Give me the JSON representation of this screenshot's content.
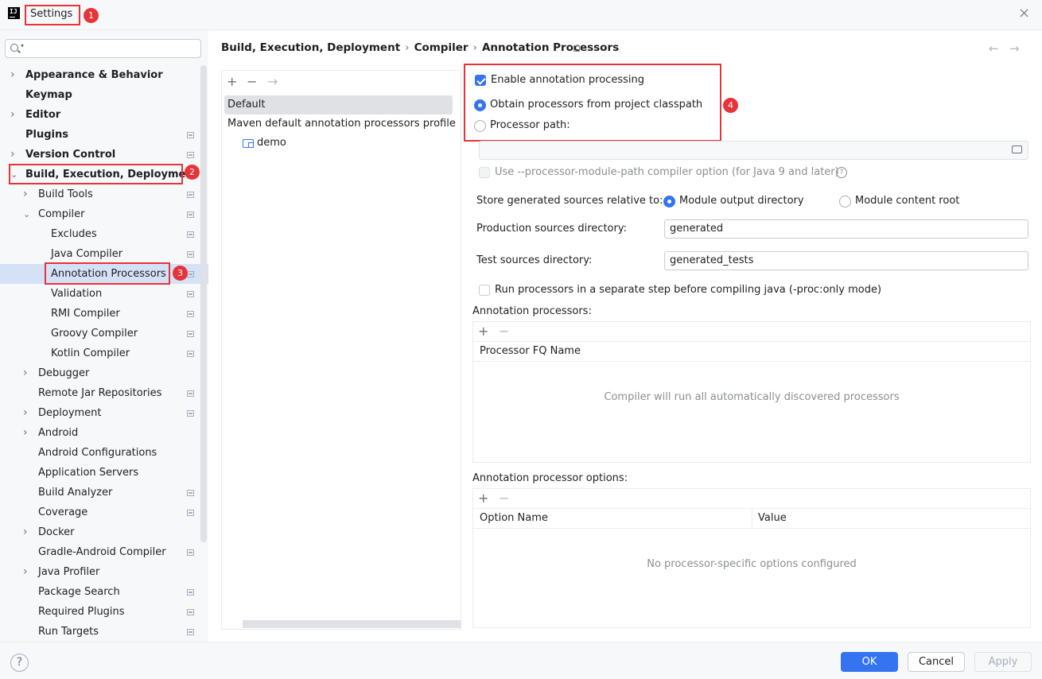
{
  "window": {
    "title": "Settings",
    "app_icon": "IJ",
    "close_icon": "×"
  },
  "badges": [
    "1",
    "2",
    "3",
    "4"
  ],
  "search": {
    "value": "",
    "placeholder": ""
  },
  "tree": [
    {
      "label": "Appearance & Behavior",
      "bold": true,
      "chevron": "right",
      "level": 0,
      "pin": false
    },
    {
      "label": "Keymap",
      "bold": true,
      "chevron": "",
      "level": 0,
      "pin": false
    },
    {
      "label": "Editor",
      "bold": true,
      "chevron": "right",
      "level": 0,
      "pin": false
    },
    {
      "label": "Plugins",
      "bold": true,
      "chevron": "",
      "level": 0,
      "pin": true
    },
    {
      "label": "Version Control",
      "bold": true,
      "chevron": "right",
      "level": 0,
      "pin": true
    },
    {
      "label": "Build, Execution, Deployment",
      "bold": true,
      "chevron": "down",
      "level": 0,
      "pin": false
    },
    {
      "label": "Build Tools",
      "bold": false,
      "chevron": "right",
      "level": 1,
      "pin": true
    },
    {
      "label": "Compiler",
      "bold": false,
      "chevron": "down",
      "level": 1,
      "pin": true
    },
    {
      "label": "Excludes",
      "bold": false,
      "chevron": "",
      "level": 2,
      "pin": true
    },
    {
      "label": "Java Compiler",
      "bold": false,
      "chevron": "",
      "level": 2,
      "pin": true
    },
    {
      "label": "Annotation Processors",
      "bold": false,
      "chevron": "",
      "level": 2,
      "pin": true,
      "selected": true
    },
    {
      "label": "Validation",
      "bold": false,
      "chevron": "",
      "level": 2,
      "pin": true
    },
    {
      "label": "RMI Compiler",
      "bold": false,
      "chevron": "",
      "level": 2,
      "pin": true
    },
    {
      "label": "Groovy Compiler",
      "bold": false,
      "chevron": "",
      "level": 2,
      "pin": true
    },
    {
      "label": "Kotlin Compiler",
      "bold": false,
      "chevron": "",
      "level": 2,
      "pin": true
    },
    {
      "label": "Debugger",
      "bold": false,
      "chevron": "right",
      "level": 1,
      "pin": false
    },
    {
      "label": "Remote Jar Repositories",
      "bold": false,
      "chevron": "",
      "level": 1,
      "pin": true
    },
    {
      "label": "Deployment",
      "bold": false,
      "chevron": "right",
      "level": 1,
      "pin": true
    },
    {
      "label": "Android",
      "bold": false,
      "chevron": "right",
      "level": 1,
      "pin": false
    },
    {
      "label": "Android Configurations",
      "bold": false,
      "chevron": "",
      "level": 1,
      "pin": false
    },
    {
      "label": "Application Servers",
      "bold": false,
      "chevron": "",
      "level": 1,
      "pin": false
    },
    {
      "label": "Build Analyzer",
      "bold": false,
      "chevron": "",
      "level": 1,
      "pin": true
    },
    {
      "label": "Coverage",
      "bold": false,
      "chevron": "",
      "level": 1,
      "pin": true
    },
    {
      "label": "Docker",
      "bold": false,
      "chevron": "right",
      "level": 1,
      "pin": false
    },
    {
      "label": "Gradle-Android Compiler",
      "bold": false,
      "chevron": "",
      "level": 1,
      "pin": true
    },
    {
      "label": "Java Profiler",
      "bold": false,
      "chevron": "right",
      "level": 1,
      "pin": false
    },
    {
      "label": "Package Search",
      "bold": false,
      "chevron": "",
      "level": 1,
      "pin": true
    },
    {
      "label": "Required Plugins",
      "bold": false,
      "chevron": "",
      "level": 1,
      "pin": true
    },
    {
      "label": "Run Targets",
      "bold": false,
      "chevron": "",
      "level": 1,
      "pin": true
    }
  ],
  "breadcrumb": [
    "Build, Execution, Deployment",
    "Compiler",
    "Annotation Processors"
  ],
  "profiles": {
    "tools": {
      "add": "+",
      "remove": "−",
      "move": "→"
    },
    "items": [
      "Default",
      "Maven default annotation processors profile",
      "demo"
    ]
  },
  "settings": {
    "enable_label": "Enable annotation processing",
    "enable_checked": true,
    "obtain_label": "Obtain processors from project classpath",
    "processor_path_label": "Processor path:",
    "processor_path_value": "",
    "module_path_label": "Use --processor-module-path compiler option (for Java 9 and later)",
    "help_q": "?",
    "store_label": "Store generated sources relative to:",
    "module_output_label": "Module output directory",
    "module_content_label": "Module content root",
    "prod_label": "Production sources directory:",
    "prod_value": "generated",
    "test_label": "Test sources directory:",
    "test_value": "generated_tests",
    "separate_step_label": "Run processors in a separate step before compiling java (-proc:only mode)"
  },
  "processors_table": {
    "title": "Annotation processors:",
    "add": "+",
    "remove": "−",
    "column": "Processor FQ Name",
    "empty": "Compiler will run all automatically discovered processors"
  },
  "options_table": {
    "title": "Annotation processor options:",
    "add": "+",
    "remove": "−",
    "columns": [
      "Option Name",
      "Value"
    ],
    "empty": "No processor-specific options configured"
  },
  "footer": {
    "help": "?",
    "ok": "OK",
    "cancel": "Cancel",
    "apply": "Apply"
  },
  "colors": {
    "accent": "#3574f0",
    "highlight": "#e5343a",
    "selection": "#d5e1f7"
  }
}
